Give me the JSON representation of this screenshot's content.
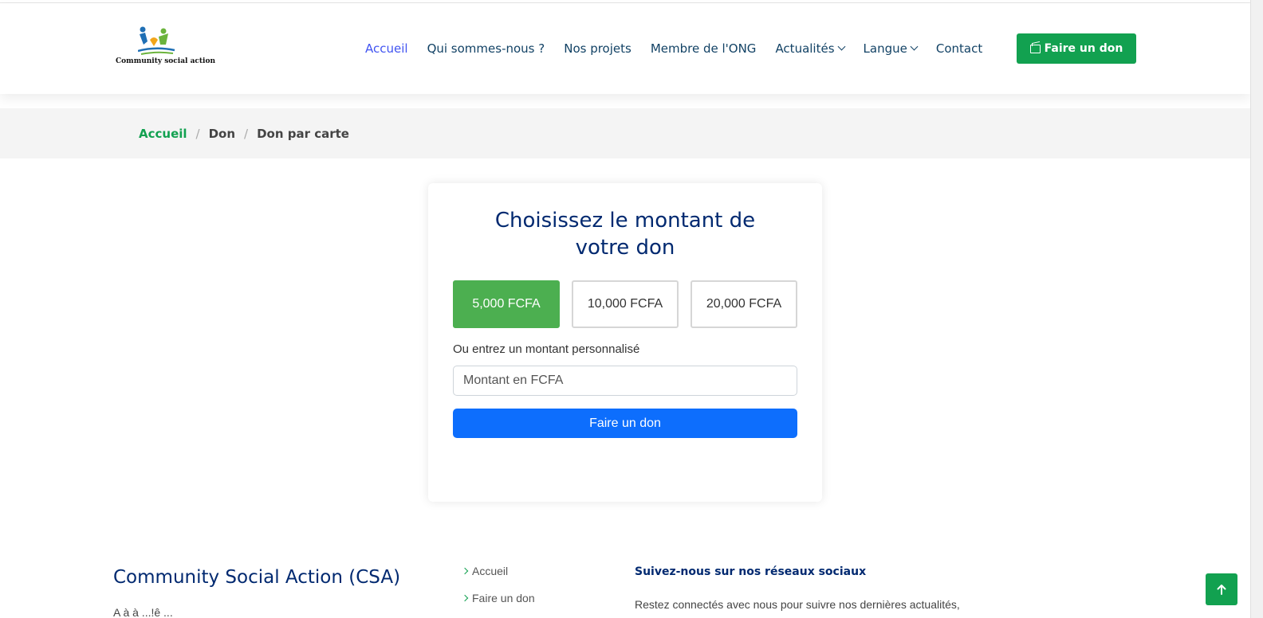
{
  "header": {
    "logo_text": "Community social action",
    "nav": [
      {
        "label": "Accueil"
      },
      {
        "label": "Qui sommes-nous ?"
      },
      {
        "label": "Nos projets"
      },
      {
        "label": "Membre de l'ONG"
      },
      {
        "label": "Actualités"
      },
      {
        "label": "Langue"
      },
      {
        "label": "Contact"
      }
    ],
    "cta_label": "Faire un don"
  },
  "breadcrumb": {
    "items": [
      "Accueil",
      "Don",
      "Don par carte"
    ],
    "separator": "/"
  },
  "donation": {
    "title": "Choisissez le montant de votre don",
    "amounts": [
      "5,000 FCFA",
      "10,000 FCFA",
      "20,000 FCFA"
    ],
    "selected_amount": "5,000 FCFA",
    "custom_label": "Ou entrez un montant personnalisé",
    "custom_placeholder": "Montant en FCFA",
    "submit_label": "Faire un don"
  },
  "footer": {
    "org_title": "Community Social Action (CSA)",
    "org_subtitle": "A à à ...!ê ...",
    "links": [
      "Accueil",
      "Faire un don"
    ],
    "social_title": "Suivez-nous sur nos réseaux sociaux",
    "social_text": "Restez connectés avec nous pour suivre nos dernières actualités,"
  },
  "colors": {
    "brand_green": "#12a150",
    "selected_amount": "#4caf50",
    "primary_blue": "#0d6efd",
    "nav_active": "#4154f1",
    "navy_text": "#012970"
  }
}
